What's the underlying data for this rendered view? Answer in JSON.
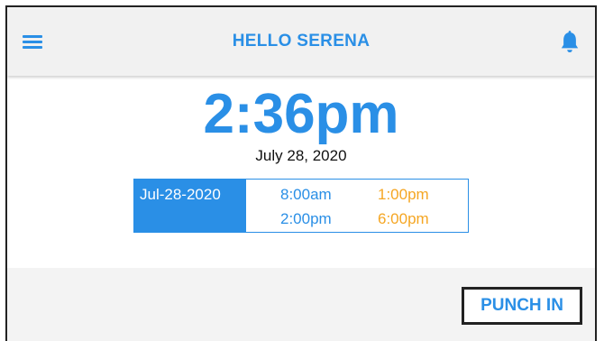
{
  "header": {
    "title": "HELLO SERENA",
    "menu_icon": "menu-icon",
    "notification_icon": "bell-icon"
  },
  "clock": {
    "time": "2:36pm",
    "date": "July 28, 2020"
  },
  "schedule": {
    "date": "Jul-28-2020",
    "shifts": [
      {
        "start": "8:00am",
        "end": "1:00pm"
      },
      {
        "start": "2:00pm",
        "end": "6:00pm"
      }
    ]
  },
  "actions": {
    "punch_label": "PUNCH IN"
  },
  "colors": {
    "accent": "#2a8fe6",
    "end_time": "#f5a623",
    "header_bg": "#f1f1f1"
  }
}
